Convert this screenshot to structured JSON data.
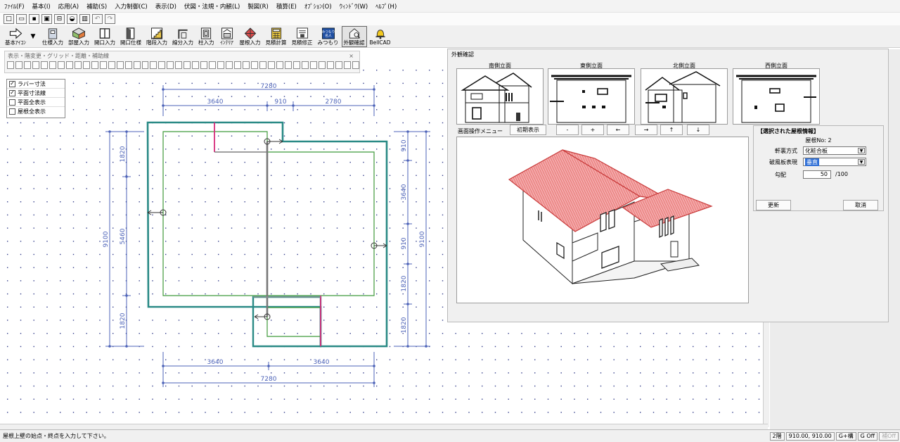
{
  "menu": {
    "items": [
      "ﾌｧｲﾙ(F)",
      "基本(I)",
      "応用(A)",
      "補助(S)",
      "入力制御(C)",
      "表示(D)",
      "伏図・法規・内観(L)",
      "製図(R)",
      "積算(E)",
      "ｵﾌﾟｼｮﾝ(O)",
      "ｳｨﾝﾄﾞｳ(W)",
      "ﾍﾙﾌﾟ(H)"
    ]
  },
  "toolbar": {
    "buttons": [
      "基本ｱｲｺﾝ",
      "仕様入力",
      "部屋入力",
      "開口入力",
      "開口仕様",
      "階段入力",
      "線分入力",
      "柱入力",
      "ｲﾝﾃﾘｱ",
      "屋根入力",
      "見積計算",
      "見積修正",
      "みつもり",
      "外観確認",
      "BellCAD"
    ],
    "pressed": "外観確認"
  },
  "subpanel": {
    "title": "表示・階変更・グリッド・距離・補助線",
    "close": "×"
  },
  "checkboxes": [
    {
      "label": "ラバー寸法",
      "checked": true
    },
    {
      "label": "平面寸法線",
      "checked": true
    },
    {
      "label": "平面全表示",
      "checked": false
    },
    {
      "label": "屋根全表示",
      "checked": false
    }
  ],
  "dimensions": {
    "top_total": "7280",
    "top_a": "3640",
    "top_b": "910",
    "top_c": "2780",
    "bottom_a": "3640",
    "bottom_b": "3640",
    "bottom_total": "7280",
    "left_total": "9100",
    "left_a": "1820",
    "left_b": "5460",
    "left_c": "1820",
    "right_total": "9100",
    "right_a": "910",
    "right_b": "3640",
    "right_c": "910",
    "right_d": "1820",
    "right_e": "1820"
  },
  "dialog": {
    "title": "外観確認",
    "elevations": [
      "南側立面",
      "東側立面",
      "北側立面",
      "西側立面"
    ],
    "op_menu": "画面操作メニュー",
    "op_buttons": [
      "初期表示",
      "-",
      "+",
      "←",
      "→",
      "↑",
      "↓"
    ],
    "roof_info": {
      "title": "【選択された屋根情報】",
      "roof_no": "屋根No: 2",
      "eaves_label": "軒裏方式",
      "eaves_value": "化粧合板",
      "fascia_label": "破風板表現",
      "fascia_value": "垂直",
      "pitch_label": "勾配",
      "pitch_value": "50",
      "pitch_unit": "/100",
      "update": "更新",
      "cancel": "取消"
    }
  },
  "status": {
    "message": "屋根上壁の始点・終点を入力して下さい。",
    "floor": "2階",
    "coords": "910.00, 910.00",
    "snap": "G+構",
    "grid": "G Off",
    "extra": "補Off"
  }
}
